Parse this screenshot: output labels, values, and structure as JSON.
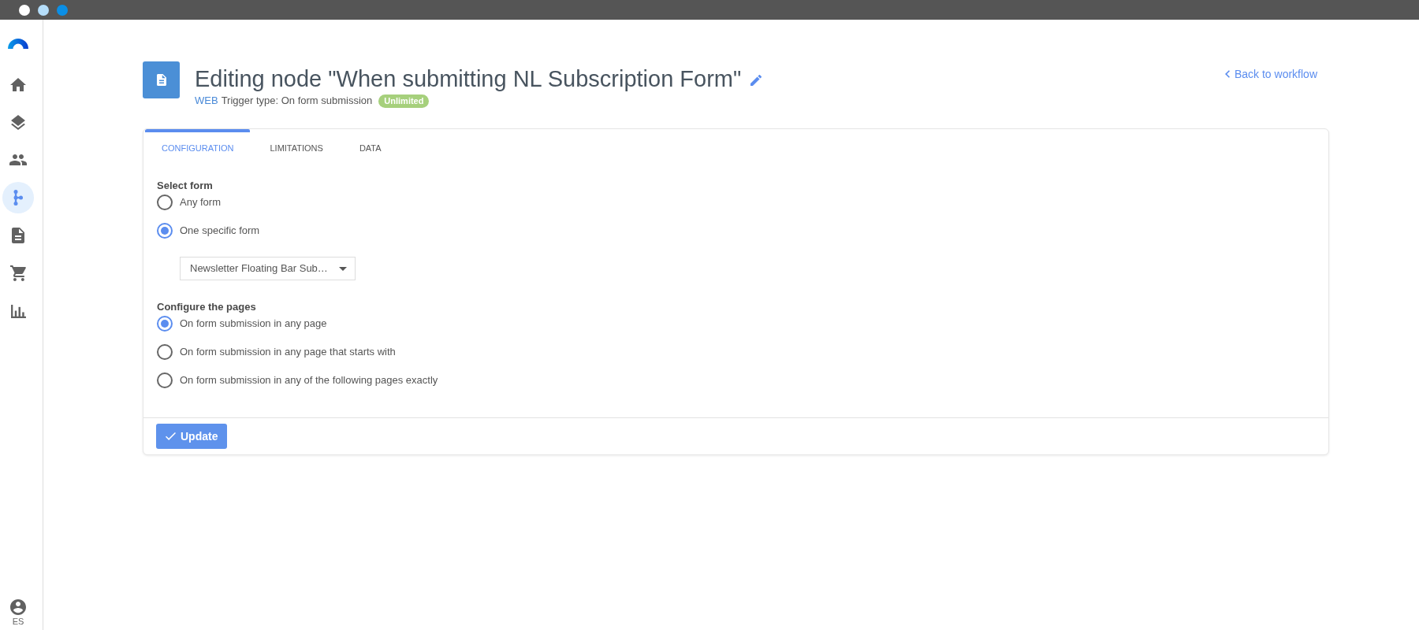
{
  "title_bar": {
    "buttons": [
      {
        "color": "#ffffff"
      },
      {
        "color": "#b5defa"
      },
      {
        "color": "#0b8fe6"
      }
    ]
  },
  "sidebar": {
    "items": [
      {
        "selected": false
      },
      {
        "selected": false
      },
      {
        "selected": false
      },
      {
        "selected": true
      },
      {
        "selected": false
      },
      {
        "selected": false
      },
      {
        "selected": false
      }
    ],
    "user": {
      "language": "ES"
    }
  },
  "header": {
    "title": "Editing node \"When submitting NL Subscription Form\"",
    "channel": "WEB",
    "trigger_type": "Trigger type: On form submission",
    "badge": "Unlimited",
    "back_link": "Back to workflow"
  },
  "tabs": [
    {
      "label": "CONFIGURATION",
      "selected": true
    },
    {
      "label": "LIMITATIONS",
      "selected": false
    },
    {
      "label": "DATA",
      "selected": false
    }
  ],
  "form": {
    "sections": [
      {
        "title": "Select form",
        "options": [
          {
            "label": "Any form",
            "selected": false
          },
          {
            "label": "One specific form",
            "selected": true
          }
        ],
        "dropdown": {
          "value": "Newsletter Floating Bar Sub…"
        }
      },
      {
        "title": "Configure the pages",
        "options": [
          {
            "label": "On form submission in any page",
            "selected": true
          },
          {
            "label": "On form submission in any page that starts with",
            "selected": false
          },
          {
            "label": "On form submission in any of the following pages exactly",
            "selected": false
          }
        ]
      }
    ]
  },
  "footer": {
    "button": "Update"
  }
}
